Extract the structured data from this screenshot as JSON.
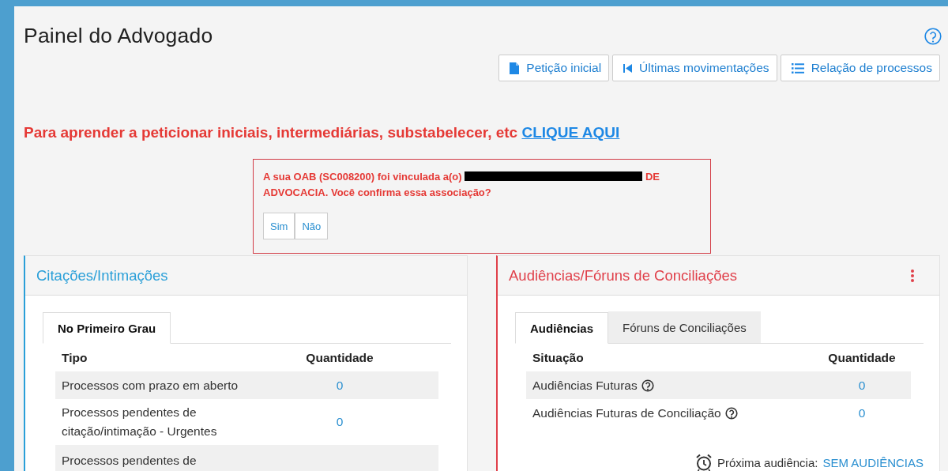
{
  "page": {
    "title": "Painel do Advogado"
  },
  "toolbar": [
    {
      "label": "Petição inicial",
      "kind": "file"
    },
    {
      "label": "Últimas movimentações",
      "kind": "first"
    },
    {
      "label": "Relação de processos",
      "kind": "list"
    }
  ],
  "notice": {
    "text": "Para aprender a peticionar iniciais, intermediárias, substabelecer, etc",
    "link": "CLIQUE AQUI"
  },
  "alert": {
    "text_before": "A sua OAB (SC008200) foi vinculada a(o)",
    "text_after": "DE ADVOCACIA. Você confirma essa associação?",
    "buttons": [
      "Sim",
      "Não"
    ]
  },
  "cards": [
    {
      "title": "Citações/Intimações",
      "color": "#2a9fd8",
      "menu": false,
      "tabs": [
        {
          "label": "No Primeiro Grau",
          "selected": true
        }
      ],
      "columns": [
        "Tipo",
        "Quantidade"
      ],
      "rows": [
        {
          "label": "Processos com prazo em aberto",
          "value": "0",
          "help": false
        },
        {
          "label": "Processos pendentes de citação/intimação - Urgentes",
          "value": "0",
          "help": false
        },
        {
          "label": "Processos pendentes de",
          "help": false
        }
      ]
    },
    {
      "title": "Audiências/Fóruns de Conciliações",
      "color": "#e0404a",
      "menu": true,
      "tabs": [
        {
          "label": "Audiências",
          "selected": true
        },
        {
          "label": "Fóruns de Conciliações",
          "selected": false
        }
      ],
      "columns": [
        "Situação",
        "Quantidade"
      ],
      "rows": [
        {
          "label": "Audiências Futuras",
          "value": "0",
          "help": true
        },
        {
          "label": "Audiências Futuras de Conciliação",
          "value": "0",
          "help": true
        }
      ],
      "footer": {
        "label": "Próxima audiência:",
        "link": "SEM AUDIÊNCIAS"
      }
    }
  ]
}
